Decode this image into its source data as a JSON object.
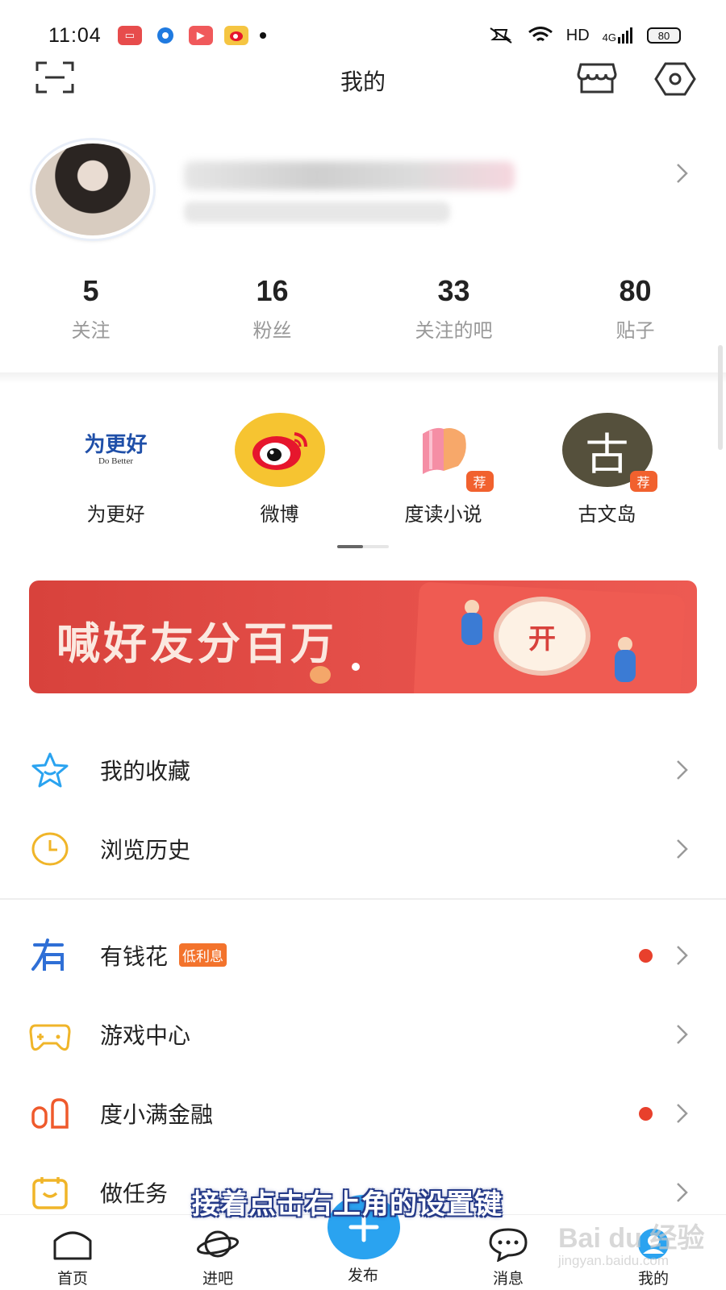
{
  "status_bar": {
    "time": "11:04",
    "network": "HD",
    "signal": "4G",
    "battery": "80"
  },
  "header": {
    "title": "我的",
    "left_icon": "scan-icon",
    "right_icons": [
      "shop-icon",
      "settings-icon"
    ]
  },
  "stats": [
    {
      "value": "5",
      "label": "关注"
    },
    {
      "value": "16",
      "label": "粉丝"
    },
    {
      "value": "33",
      "label": "关注的吧"
    },
    {
      "value": "80",
      "label": "贴子"
    }
  ],
  "apps": [
    {
      "label": "为更好",
      "logo_text": "为更好",
      "logo_sub": "Do Better"
    },
    {
      "label": "微博"
    },
    {
      "label": "度读小说",
      "badge": "荐"
    },
    {
      "label": "古文岛",
      "logo_text": "古",
      "badge": "荐"
    }
  ],
  "banner": {
    "text": "喊好友分百万",
    "button": "开"
  },
  "menu_group1": [
    {
      "label": "我的收藏",
      "icon": "star-icon"
    },
    {
      "label": "浏览历史",
      "icon": "clock-icon"
    }
  ],
  "menu_group2": [
    {
      "label": "有钱花",
      "badge": "低利息",
      "icon": "youqianhua-icon",
      "dot": true
    },
    {
      "label": "游戏中心",
      "icon": "gamepad-icon",
      "dot": false
    },
    {
      "label": "度小满金融",
      "icon": "duxiaoman-icon",
      "dot": true
    },
    {
      "label": "做任务",
      "icon": "task-calendar-icon",
      "dot": false
    }
  ],
  "caption": "接着点击右上角的设置键",
  "tabs": [
    {
      "label": "首页",
      "icon": "home-icon"
    },
    {
      "label": "进吧",
      "icon": "planet-icon"
    },
    {
      "label": "发布",
      "icon": "plus-icon"
    },
    {
      "label": "消息",
      "icon": "chat-bubble-icon"
    },
    {
      "label": "我的",
      "icon": "profile-icon"
    }
  ],
  "watermark": {
    "main": "Bai du 经验",
    "sub": "jingyan.baidu.com"
  },
  "colors": {
    "accent_blue": "#2aa3f0",
    "badge_orange": "#f1612e",
    "alert_red": "#e8402c",
    "banner_red": "#d8423c"
  }
}
